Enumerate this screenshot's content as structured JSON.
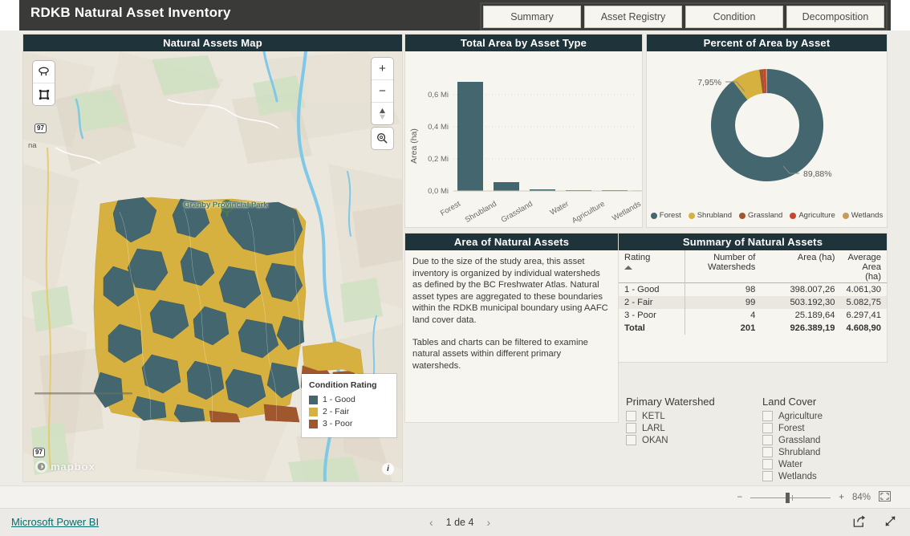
{
  "header": {
    "title": "RDKB Natural Asset Inventory",
    "tabs": [
      {
        "label": "Summary"
      },
      {
        "label": "Asset Registry"
      },
      {
        "label": "Condition"
      },
      {
        "label": "Decomposition"
      }
    ]
  },
  "map": {
    "title": "Natural Assets Map",
    "park_label": "Granby Provincial Park",
    "town_label": "na",
    "highway_shield_top": "97",
    "highway_shield_bottom": "97",
    "attribution": "mapbox",
    "controls": {
      "lasso_select": "lasso-select",
      "box_select": "box-select",
      "zoom_in": "+",
      "zoom_out": "−",
      "compass": "compass",
      "locate": "locate"
    },
    "legend": {
      "title": "Condition Rating",
      "items": [
        {
          "label": "1 - Good",
          "color": "#44666f"
        },
        {
          "label": "2 - Fair",
          "color": "#d7b13f"
        },
        {
          "label": "3 - Poor",
          "color": "#a0572e"
        }
      ]
    }
  },
  "bar_card": {
    "title": "Total Area by Asset Type"
  },
  "donut_card": {
    "title": "Percent of Area by Asset"
  },
  "text_card": {
    "title": "Area of Natural Assets",
    "paragraphs": [
      "Due to the size of the study area, this asset inventory is organized by individual watersheds as defined by the BC Freshwater Atlas. Natural asset types are aggregated to these boundaries within the RDKB municipal boundary using AAFC land cover data.",
      "Tables and charts can be filtered to examine natural assets within different primary watersheds."
    ]
  },
  "table_card": {
    "title": "Summary of Natural Assets",
    "columns": [
      "Rating",
      "Number of Watersheds",
      "Area (ha)",
      "Average Area (ha)"
    ],
    "rows": [
      {
        "rating": "1 - Good",
        "watersheds": "98",
        "area": "398.007,26",
        "avg": "4.061,30"
      },
      {
        "rating": "2 - Fair",
        "watersheds": "99",
        "area": "503.192,30",
        "avg": "5.082,75"
      },
      {
        "rating": "3 - Poor",
        "watersheds": "4",
        "area": "25.189,64",
        "avg": "6.297,41"
      }
    ],
    "total": {
      "rating": "Total",
      "watersheds": "201",
      "area": "926.389,19",
      "avg": "4.608,90"
    }
  },
  "slicers": {
    "watershed": {
      "title": "Primary Watershed",
      "options": [
        "KETL",
        "LARL",
        "OKAN"
      ]
    },
    "landcover": {
      "title": "Land Cover",
      "options": [
        "Agriculture",
        "Forest",
        "Grassland",
        "Shrubland",
        "Water",
        "Wetlands"
      ]
    }
  },
  "statusbar": {
    "zoom_level": "84%",
    "minus": "−",
    "plus": "+",
    "fit_icon": "fit-to-page"
  },
  "footer": {
    "link": "Microsoft Power BI",
    "page_indicator": "1 de 4",
    "prev": "‹",
    "next": "›"
  },
  "chart_data": [
    {
      "type": "bar",
      "title": "Total Area by Asset Type",
      "categories": [
        "Forest",
        "Shrubland",
        "Grassland",
        "Water",
        "Agriculture",
        "Wetlands"
      ],
      "values": [
        0.68,
        0.055,
        0.009,
        0.004,
        0.0035,
        0.0015
      ],
      "value_unit": "Mi ha",
      "xlabel": "",
      "ylabel": "Area (ha)",
      "ylim": [
        0,
        0.72
      ],
      "yticks": [
        0,
        0.2,
        0.4,
        0.6
      ],
      "ytick_labels": [
        "0,0 Mi",
        "0,2 Mi",
        "0,4 Mi",
        "0,6 Mi"
      ],
      "grid": true,
      "bar_color": "#44666f",
      "legend": "none"
    },
    {
      "type": "pie",
      "title": "Percent of Area by Asset",
      "subtype": "donut",
      "labels": [
        "Forest",
        "Shrubland",
        "Grassland",
        "Agriculture",
        "Wetlands"
      ],
      "values": [
        89.88,
        7.95,
        1.1,
        0.85,
        0.22
      ],
      "annotations": [
        "89,88%",
        "7,95%"
      ],
      "colors": [
        "#44666f",
        "#d7b13f",
        "#a0572e",
        "#c8462e",
        "#c79a5b"
      ],
      "legend": "bottom"
    }
  ]
}
